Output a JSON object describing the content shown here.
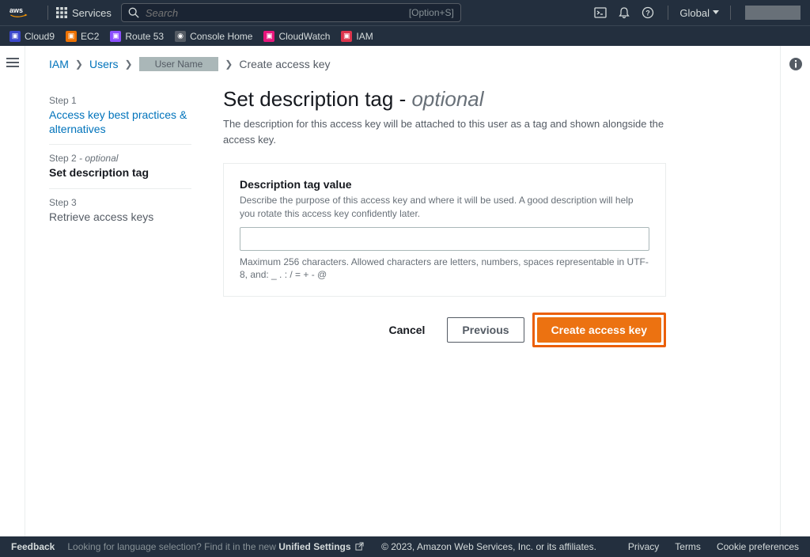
{
  "topnav": {
    "services_label": "Services",
    "search_placeholder": "Search",
    "search_shortcut": "[Option+S]",
    "region": "Global"
  },
  "favbar": [
    {
      "label": "Cloud9"
    },
    {
      "label": "EC2"
    },
    {
      "label": "Route 53"
    },
    {
      "label": "Console Home"
    },
    {
      "label": "CloudWatch"
    },
    {
      "label": "IAM"
    }
  ],
  "breadcrumb": {
    "iam": "IAM",
    "users": "Users",
    "user_name": "User Name",
    "current": "Create access key"
  },
  "steps": {
    "s1_num": "Step 1",
    "s1_label": "Access key best practices & alternatives",
    "s2_num": "Step 2",
    "s2_opt": " - optional",
    "s2_label": "Set description tag",
    "s3_num": "Step 3",
    "s3_label": "Retrieve access keys"
  },
  "page": {
    "title_main": "Set description tag -",
    "title_opt": " optional",
    "desc": "The description for this access key will be attached to this user as a tag and shown alongside the access key."
  },
  "field": {
    "label": "Description tag value",
    "help": "Describe the purpose of this access key and where it will be used. A good description will help you rotate this access key confidently later.",
    "hint": "Maximum 256 characters. Allowed characters are letters, numbers, spaces representable in UTF-8, and: _ . : / = + - @"
  },
  "actions": {
    "cancel": "Cancel",
    "previous": "Previous",
    "create": "Create access key"
  },
  "footer": {
    "feedback": "Feedback",
    "lang_q": "Looking for language selection? Find it in the new ",
    "lang_link": "Unified Settings",
    "copyright": "© 2023, Amazon Web Services, Inc. or its affiliates.",
    "privacy": "Privacy",
    "terms": "Terms",
    "cookie": "Cookie preferences"
  }
}
